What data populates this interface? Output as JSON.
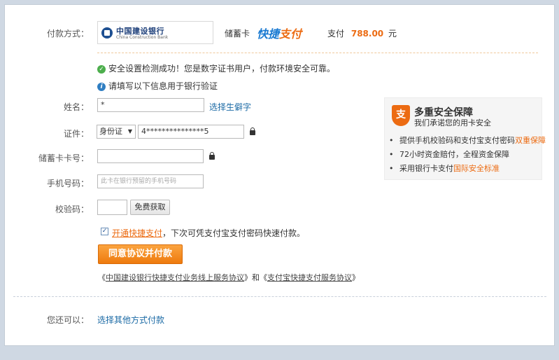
{
  "payment": {
    "method_label": "付款方式：",
    "bank_name_cn": "中国建设银行",
    "bank_name_en": "China Construction Bank",
    "card_type": "储蓄卡",
    "kuaijie_a": "快捷",
    "kuaijie_b": "支付",
    "pay_label": "支付",
    "amount": "788.00",
    "currency": "元"
  },
  "notices": {
    "security_ok": "安全设置检测成功！您是数字证书用户，付款环境安全可靠。",
    "fill_info": "请填写以下信息用于银行验证"
  },
  "form": {
    "name_label": "姓名：",
    "name_value": "*",
    "rare_char_link": "选择生僻字",
    "id_label": "证件：",
    "id_type": "身份证",
    "id_value": "4***************5",
    "card_label": "储蓄卡卡号：",
    "card_value": "",
    "phone_label": "手机号码：",
    "phone_placeholder": "此卡在银行预留的手机号码",
    "code_label": "校验码：",
    "code_value": "",
    "get_code_button": "免费获取",
    "enable_quick_link": "开通快捷支付",
    "enable_quick_text": "，下次可凭支付宝支付密码快速付款。",
    "submit_button": "同意协议并付款",
    "agreement_prefix": "《",
    "agreement1": "中国建设银行快捷支付业务线上服务协议",
    "agreement_mid": "》和《",
    "agreement2": "支付宝快捷支付服务协议",
    "agreement_suffix": "》"
  },
  "security_panel": {
    "shield_glyph": "支",
    "title": "多重安全保障",
    "subtitle": "我们承诺您的用卡安全",
    "items": [
      {
        "text": "提供手机校验码和支付宝支付密码",
        "highlight": "双重保障"
      },
      {
        "text": "72小时资金赔付，全程资金保障",
        "highlight": ""
      },
      {
        "text": "采用银行卡支付",
        "highlight": "国际安全标准"
      }
    ]
  },
  "footer": {
    "other_label": "您还可以：",
    "other_link": "选择其他方式付款"
  }
}
